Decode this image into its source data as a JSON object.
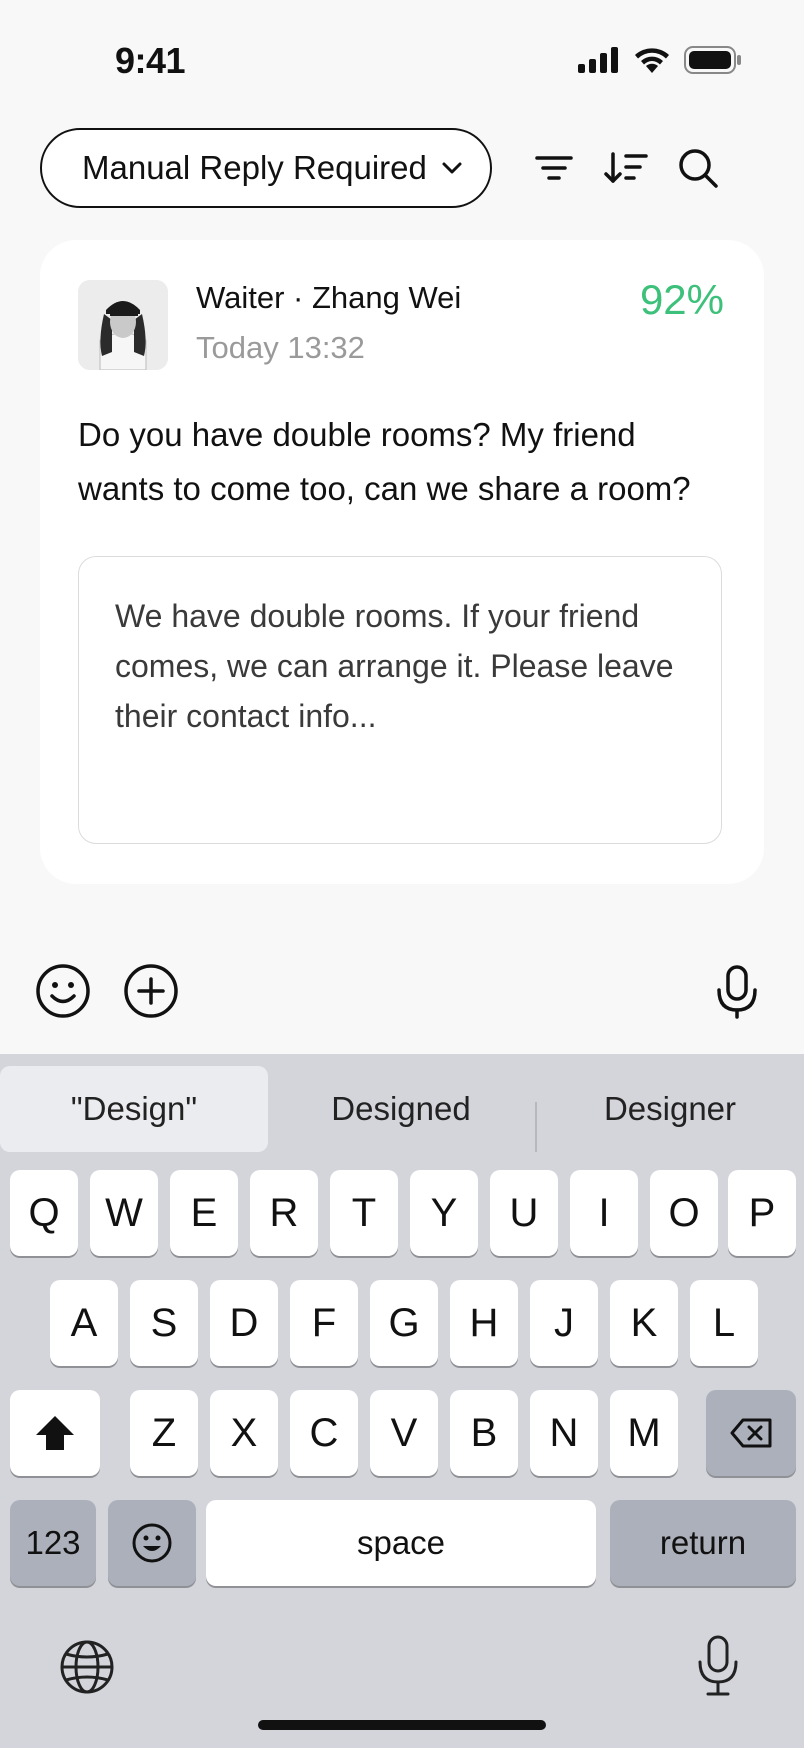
{
  "status": {
    "time": "9:41"
  },
  "header": {
    "filter_label": "Manual Reply Required"
  },
  "card": {
    "sender": "Waiter · Zhang Wei",
    "timestamp": "Today 13:32",
    "score": "92%",
    "message": "Do you have double rooms? My friend wants to come too, can we share a room?",
    "reply_draft": "We have double rooms. If your friend comes, we can arrange it. Please leave their contact info..."
  },
  "keyboard": {
    "suggestions": [
      "\"Design\"",
      "Designed",
      "Designer"
    ],
    "row1": [
      "Q",
      "W",
      "E",
      "R",
      "T",
      "Y",
      "U",
      "I",
      "O",
      "P"
    ],
    "row2": [
      "A",
      "S",
      "D",
      "F",
      "G",
      "H",
      "J",
      "K",
      "L"
    ],
    "row3": [
      "Z",
      "X",
      "C",
      "V",
      "B",
      "N",
      "M"
    ],
    "numbers_label": "123",
    "space_label": "space",
    "return_label": "return"
  },
  "colors": {
    "score": "#3cc07a",
    "keyboard_bg": "#d3d5db",
    "key_dark": "#acb0ba"
  }
}
